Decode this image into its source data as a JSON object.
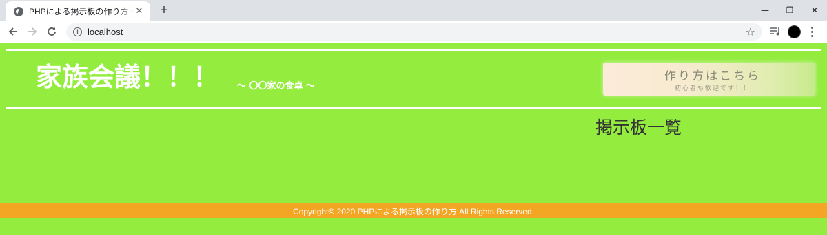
{
  "browser": {
    "tab_title": "PHPによる掲示板の作り方 〜ここは",
    "tab_close": "✕",
    "new_tab": "+",
    "url": "localhost",
    "minimize": "—",
    "restore": "❐",
    "close": "✕"
  },
  "header": {
    "title": "家族会議！！！",
    "subtitle": "〜 〇〇家の食卓 〜"
  },
  "howto_button": {
    "label": "作り方はこちら",
    "sub": "初心者も歓迎です！！"
  },
  "main": {
    "heading": "掲示板一覧"
  },
  "footer": {
    "copyright": "Copyright© 2020 PHPによる掲示板の作り方 All Rights Reserved."
  },
  "colors": {
    "page_bg": "#94ec3f",
    "footer_bg": "#f2a623",
    "rule": "#ffffff"
  }
}
